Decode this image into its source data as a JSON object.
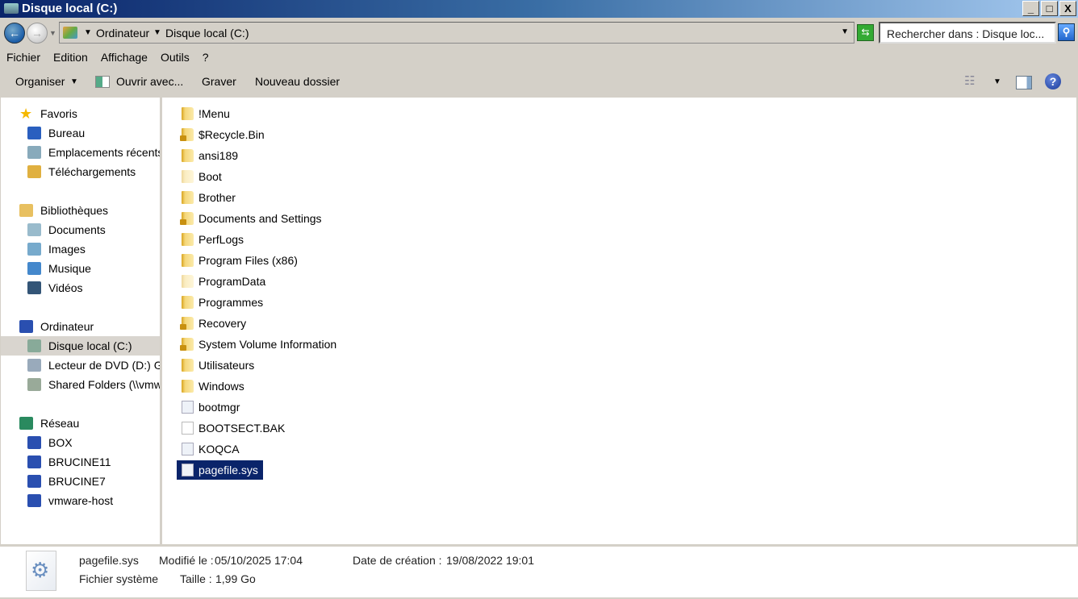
{
  "window": {
    "title": "Disque local (C:)",
    "minimize": "_",
    "maximize": "□",
    "close": "X"
  },
  "address": {
    "crumbs": [
      "Ordinateur",
      "Disque local (C:)"
    ],
    "search_placeholder": "Rechercher dans : Disque loc..."
  },
  "menu": [
    "Fichier",
    "Edition",
    "Affichage",
    "Outils",
    "?"
  ],
  "toolbar": {
    "organize": "Organiser",
    "open_with": "Ouvrir avec...",
    "burn": "Graver",
    "new_folder": "Nouveau dossier"
  },
  "sidebar": [
    {
      "label": "Favoris",
      "level": 0,
      "icon": "star-icon",
      "color": "#f5b800"
    },
    {
      "label": "Bureau",
      "level": 1,
      "icon": "desktop-icon",
      "color": "#2a5fbf"
    },
    {
      "label": "Emplacements récents",
      "level": 1,
      "icon": "recent-places-icon",
      "color": "#8ab"
    },
    {
      "label": "Téléchargements",
      "level": 1,
      "icon": "downloads-icon",
      "color": "#e0b040"
    },
    {
      "gap": true
    },
    {
      "label": "Bibliothèques",
      "level": 0,
      "icon": "libraries-icon",
      "color": "#e8c060"
    },
    {
      "label": "Documents",
      "level": 1,
      "icon": "documents-icon",
      "color": "#9bc"
    },
    {
      "label": "Images",
      "level": 1,
      "icon": "images-icon",
      "color": "#7ac"
    },
    {
      "label": "Musique",
      "level": 1,
      "icon": "music-icon",
      "color": "#48c"
    },
    {
      "label": "Vidéos",
      "level": 1,
      "icon": "videos-icon",
      "color": "#357"
    },
    {
      "gap": true
    },
    {
      "label": "Ordinateur",
      "level": 0,
      "icon": "computer-icon",
      "color": "#2a4fb0"
    },
    {
      "label": "Disque local (C:)",
      "level": 1,
      "icon": "drive-icon",
      "color": "#8a9",
      "selected": true
    },
    {
      "label": "Lecteur de DVD (D:) G",
      "level": 1,
      "icon": "dvd-drive-icon",
      "color": "#9ab"
    },
    {
      "label": "Shared Folders (\\\\vmw",
      "level": 1,
      "icon": "shared-folders-icon",
      "color": "#9a9"
    },
    {
      "gap": true
    },
    {
      "label": "Réseau",
      "level": 0,
      "icon": "network-icon",
      "color": "#2a8a5f"
    },
    {
      "label": "BOX",
      "level": 1,
      "icon": "computer-icon",
      "color": "#2a4fb0"
    },
    {
      "label": "BRUCINE11",
      "level": 1,
      "icon": "computer-icon",
      "color": "#2a4fb0"
    },
    {
      "label": "BRUCINE7",
      "level": 1,
      "icon": "computer-icon",
      "color": "#2a4fb0"
    },
    {
      "label": "vmware-host",
      "level": 1,
      "icon": "computer-icon",
      "color": "#2a4fb0"
    }
  ],
  "files": [
    {
      "name": "!Menu",
      "type": "folder"
    },
    {
      "name": "$Recycle.Bin",
      "type": "locked"
    },
    {
      "name": "ansi189",
      "type": "folder"
    },
    {
      "name": "Boot",
      "type": "hidden"
    },
    {
      "name": "Brother",
      "type": "folder"
    },
    {
      "name": "Documents and Settings",
      "type": "locked"
    },
    {
      "name": "PerfLogs",
      "type": "folder"
    },
    {
      "name": "Program Files (x86)",
      "type": "folder"
    },
    {
      "name": "ProgramData",
      "type": "hidden"
    },
    {
      "name": "Programmes",
      "type": "folder"
    },
    {
      "name": "Recovery",
      "type": "locked"
    },
    {
      "name": "System Volume Information",
      "type": "locked"
    },
    {
      "name": "Utilisateurs",
      "type": "folder"
    },
    {
      "name": "Windows",
      "type": "folder"
    },
    {
      "name": "bootmgr",
      "type": "sysfile"
    },
    {
      "name": "BOOTSECT.BAK",
      "type": "file"
    },
    {
      "name": "KOQCA",
      "type": "sysfile"
    },
    {
      "name": "pagefile.sys",
      "type": "sysfile",
      "selected": true
    }
  ],
  "details": {
    "name": "pagefile.sys",
    "type": "Fichier système",
    "modified_label": "Modifié le :",
    "modified": "05/10/2025 17:04",
    "created_label": "Date de création :",
    "created": "19/08/2022 19:01",
    "size_label": "Taille :",
    "size": "1,99 Go"
  }
}
